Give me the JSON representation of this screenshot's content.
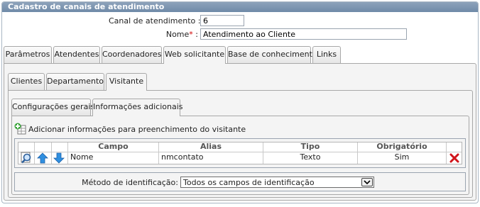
{
  "panel": {
    "title": "Cadastro de canais de atendimento"
  },
  "form": {
    "canal_label": "Canal de atendimento :",
    "canal_value": "6",
    "nome_label": "Nome",
    "nome_required": "*",
    "nome_sep": " :",
    "nome_value": "Atendimento ao Cliente"
  },
  "main_tabs": [
    "Parâmetros",
    "Atendentes",
    "Coordenadores",
    "Web solicitante",
    "Base de conhecimento",
    "Links"
  ],
  "main_tab_active": "Web solicitante",
  "sub_tabs": [
    "Clientes",
    "Departamento",
    "Visitante"
  ],
  "sub_tab_active": "Visitante",
  "inner_tabs": [
    "Configurações gerais",
    "Informações adicionais"
  ],
  "inner_tab_active": "Informações adicionais",
  "add_action": {
    "label": "Adicionar informações para preenchimento do visitante",
    "icon": "add-table-icon"
  },
  "table": {
    "headers": {
      "campo": "Campo",
      "alias": "Alias",
      "tipo": "Tipo",
      "obrigatorio": "Obrigatório"
    },
    "rows": [
      {
        "campo": "Nome",
        "alias": "nmcontato",
        "tipo": "Texto",
        "obrigatorio": "Sim"
      }
    ]
  },
  "identificacao": {
    "label": "Método de identificação:",
    "selected": "Todos os campos de identificação"
  },
  "colors": {
    "title_bar": "#7f97b2",
    "delete": "#d0141a",
    "arrow": "#2f8fe0"
  }
}
